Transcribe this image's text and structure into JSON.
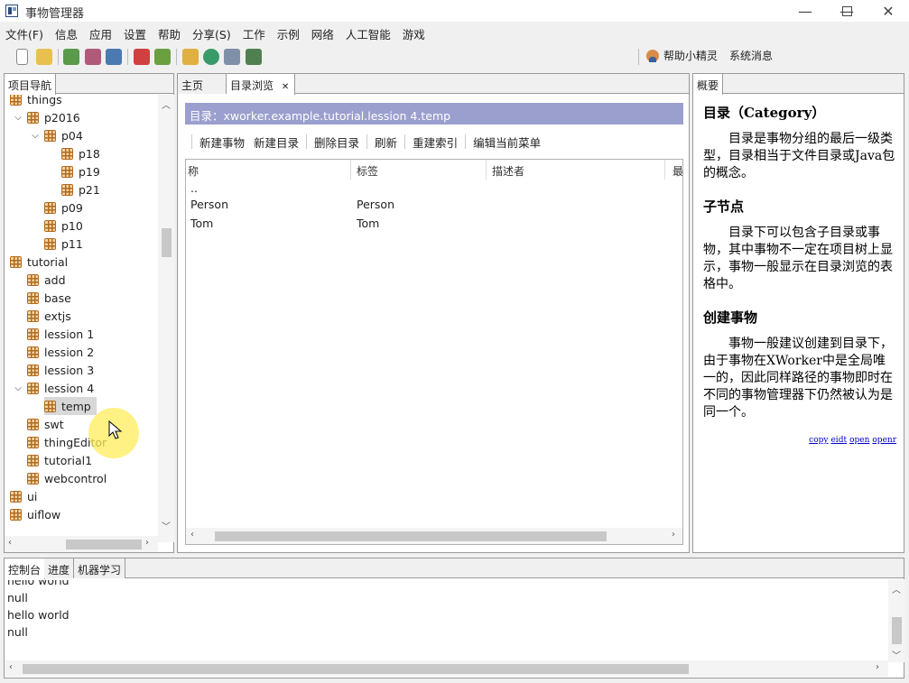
{
  "window": {
    "title": "事物管理器"
  },
  "menu": [
    "文件(F)",
    "信息",
    "应用",
    "设置",
    "帮助",
    "分享(S)",
    "工作",
    "示例",
    "网络",
    "人工智能",
    "游戏"
  ],
  "toolbar": {
    "helper_label": "帮助小精灵",
    "messages_label": "系统消息"
  },
  "nav": {
    "tab_label": "项目导航",
    "items": [
      {
        "label": "things",
        "level": 0,
        "chevron": ""
      },
      {
        "label": "p2016",
        "level": 0,
        "chevron": "v"
      },
      {
        "label": "p04",
        "level": 1,
        "chevron": "v"
      },
      {
        "label": "p18",
        "level": 2,
        "chevron": ""
      },
      {
        "label": "p19",
        "level": 2,
        "chevron": ""
      },
      {
        "label": "p21",
        "level": 2,
        "chevron": ""
      },
      {
        "label": "p09",
        "level": 1,
        "chevron": ""
      },
      {
        "label": "p10",
        "level": 1,
        "chevron": ""
      },
      {
        "label": "p11",
        "level": 1,
        "chevron": ""
      },
      {
        "label": "tutorial",
        "level": -1,
        "chevron": ""
      },
      {
        "label": "add",
        "level": 0,
        "chevron": ""
      },
      {
        "label": "base",
        "level": 0,
        "chevron": ""
      },
      {
        "label": "extjs",
        "level": 0,
        "chevron": ""
      },
      {
        "label": "lession 1",
        "level": 0,
        "chevron": ""
      },
      {
        "label": "lession 2",
        "level": 0,
        "chevron": ""
      },
      {
        "label": "lession 3",
        "level": 0,
        "chevron": ""
      },
      {
        "label": "lession 4",
        "level": 0,
        "chevron": "v"
      },
      {
        "label": "temp",
        "level": 1,
        "chevron": "",
        "selected": true
      },
      {
        "label": "swt",
        "level": 0,
        "chevron": ""
      },
      {
        "label": "thingEditor",
        "level": 0,
        "chevron": ""
      },
      {
        "label": "tutorial1",
        "level": 0,
        "chevron": ""
      },
      {
        "label": "webcontrol",
        "level": 0,
        "chevron": ""
      },
      {
        "label": "ui",
        "level": -1,
        "chevron": ""
      },
      {
        "label": "uiflow",
        "level": -1,
        "chevron": ""
      }
    ]
  },
  "center": {
    "tabs": [
      "主页",
      "目录浏览"
    ],
    "dir_path": "目录：xworker.example.tutorial.lession 4.temp",
    "actions": [
      "新建事物",
      "新建目录",
      "删除目录",
      "刷新",
      "重建索引",
      "编辑当前菜单"
    ],
    "columns": [
      "称",
      "标签",
      "描述者",
      "最"
    ],
    "rows": [
      [
        "..",
        ""
      ],
      [
        "Person",
        "Person"
      ],
      [
        "Tom",
        "Tom"
      ]
    ]
  },
  "overview": {
    "tab_label": "概要",
    "sections": [
      {
        "heading": "目录（Category）",
        "text": "目录是事物分组的最后一级类型，目录相当于文件目录或Java包的概念。"
      },
      {
        "heading": "子节点",
        "text": "目录下可以包含子目录或事物，其中事物不一定在项目树上显示，事物一般显示在目录浏览的表格中。"
      },
      {
        "heading": "创建事物",
        "text": "事物一般建议创建到目录下，由于事物在XWorker中是全局唯一的，因此同样路径的事物即时在不同的事物管理器下仍然被认为是同一个。"
      }
    ],
    "links": [
      "copy",
      "eidt",
      "open",
      "openr"
    ]
  },
  "console": {
    "tabs": [
      "控制台",
      "进度",
      "机器学习"
    ],
    "lines": [
      "hello world",
      "null",
      "hello world",
      "null"
    ]
  }
}
